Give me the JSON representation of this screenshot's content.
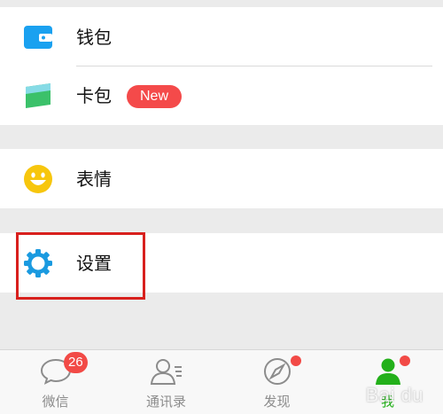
{
  "menu": {
    "wallet": {
      "label": "钱包",
      "icon": "wallet-icon"
    },
    "card": {
      "label": "卡包",
      "icon": "card-icon",
      "badge": "New"
    },
    "emoji": {
      "label": "表情",
      "icon": "emoji-icon"
    },
    "settings": {
      "label": "设置",
      "icon": "gear-icon"
    }
  },
  "tabbar": {
    "tabs": [
      {
        "label": "微信",
        "icon": "chat-bubble-icon",
        "badge": "26"
      },
      {
        "label": "通讯录",
        "icon": "contacts-icon"
      },
      {
        "label": "发现",
        "icon": "compass-icon",
        "dot": true
      },
      {
        "label": "我",
        "icon": "person-icon",
        "dot": true,
        "active": true
      }
    ]
  },
  "watermark": "Bai du",
  "colors": {
    "accent": "#23b01a",
    "badge": "#f44a4a",
    "highlight": "#d8201d",
    "icon_blue": "#1aa1f0",
    "card_green": "#3bc16a",
    "emoji_yellow": "#f7c60d"
  }
}
